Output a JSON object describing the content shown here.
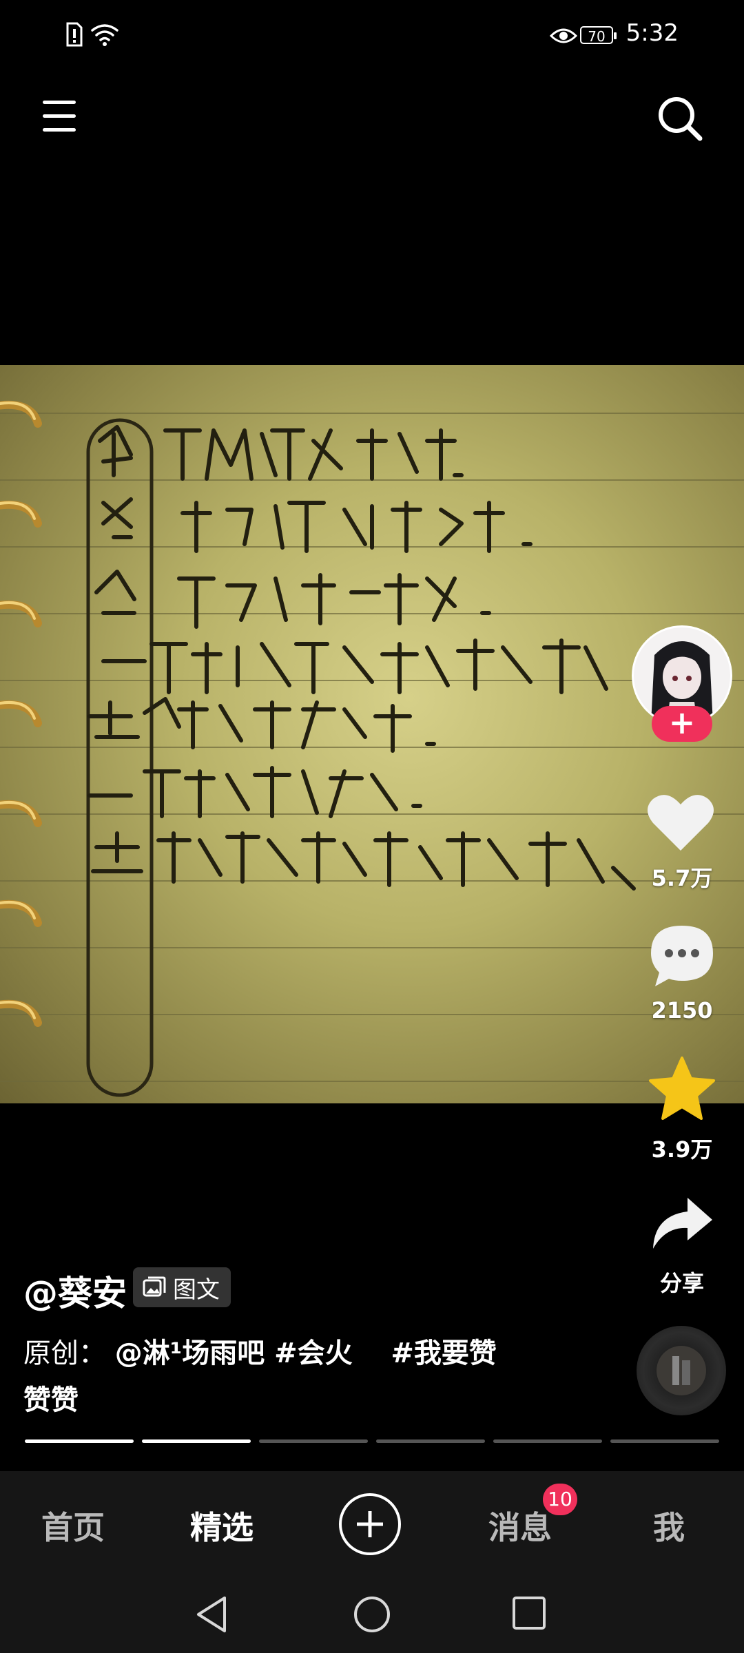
{
  "status_bar": {
    "time": "5:32",
    "battery": "70",
    "icons": [
      "sim-alert-icon",
      "wifi-icon",
      "eye-icon",
      "battery-icon"
    ]
  },
  "top_bar": {
    "icons": [
      "menu-icon",
      "search-icon"
    ]
  },
  "post": {
    "author": "@葵安",
    "type_badge": "图文",
    "caption_line1_prefix": "原创：",
    "caption_line1_tags": "@淋¹场雨吧 #会火    #我要赞",
    "caption_line2": "赞赞",
    "progress": {
      "total": 6,
      "viewed": 2
    }
  },
  "actions": {
    "likes": "5.7万",
    "comments": "2150",
    "favorites": "3.9万",
    "share": "分享"
  },
  "bottom_nav": {
    "items": [
      "首页",
      "精选",
      "消息",
      "我"
    ],
    "active": "精选",
    "messages_badge": "10"
  },
  "colors": {
    "accent": "#f0305b",
    "favorite": "#f5c518",
    "background": "#000000",
    "nav_background": "#161616"
  }
}
